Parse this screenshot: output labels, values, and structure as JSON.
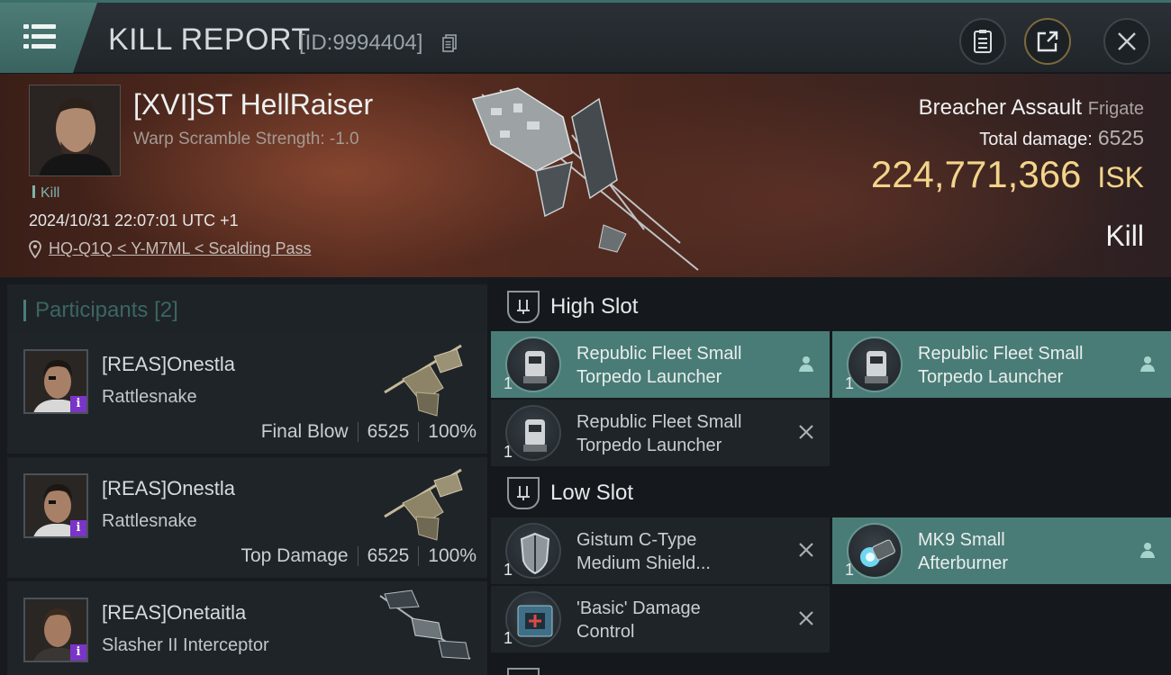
{
  "header": {
    "title": "KILL REPORT",
    "report_id": "[ID:9994404]"
  },
  "victim": {
    "pilot_name": "[XVI]ST HellRaiser",
    "scramble": "Warp Scramble Strength: -1.0",
    "kill_tag": "Kill",
    "datetime": "2024/10/31 22:07:01 UTC +1",
    "location": "HQ-Q1Q < Y-M7ML < Scalding Pass",
    "ship_name": "Breacher Assault",
    "ship_class": "Frigate",
    "total_damage_label": "Total damage:",
    "total_damage": "6525",
    "isk_value": "224,771,366",
    "isk_unit": "ISK",
    "result": "Kill"
  },
  "participants": {
    "label": "Participants",
    "count": "[2]",
    "rows": [
      {
        "name": "[REAS]Onestla",
        "ship": "Rattlesnake",
        "role": "Final Blow",
        "damage": "6525",
        "percent": "100%"
      },
      {
        "name": "[REAS]Onestla",
        "ship": "Rattlesnake",
        "role": "Top Damage",
        "damage": "6525",
        "percent": "100%"
      },
      {
        "name": "[REAS]Onetaitla",
        "ship": "Slasher II Interceptor"
      }
    ]
  },
  "fitting": {
    "high_slot_label": "High Slot",
    "low_slot_label": "Low Slot",
    "high": [
      {
        "name": "Republic Fleet Small\nTorpedo Launcher",
        "qty": "1",
        "status": "dropped"
      },
      {
        "name": "Republic Fleet Small\nTorpedo Launcher",
        "qty": "1",
        "status": "dropped"
      },
      {
        "name": "Republic Fleet Small\nTorpedo Launcher",
        "qty": "1",
        "status": "destroyed"
      }
    ],
    "low": [
      {
        "name": "Gistum C-Type\nMedium Shield...",
        "qty": "1",
        "status": "destroyed"
      },
      {
        "name": "MK9 Small\nAfterburner",
        "qty": "1",
        "status": "dropped"
      },
      {
        "name": "'Basic' Damage\nControl",
        "qty": "1",
        "status": "destroyed"
      }
    ]
  },
  "colors": {
    "accent": "#4a7c77",
    "isk": "#f3d48a",
    "info_badge": "#7a35c7"
  }
}
